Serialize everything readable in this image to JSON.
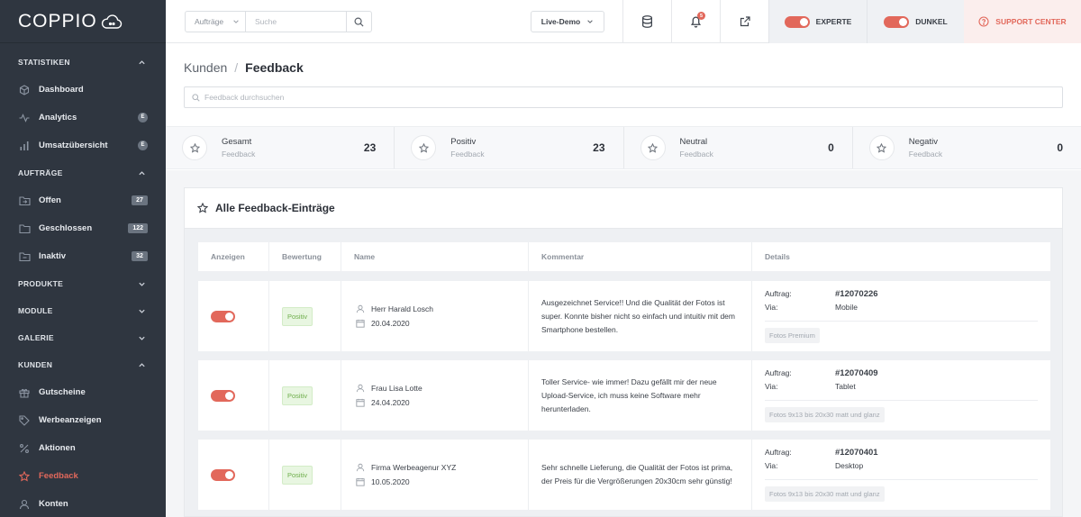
{
  "app": {
    "logo": "COPPIO"
  },
  "sidebar": {
    "sections": [
      {
        "label": "STATISTIKEN"
      },
      {
        "label": "AUFTRÄGE"
      },
      {
        "label": "PRODUKTE"
      },
      {
        "label": "MODULE"
      },
      {
        "label": "GALERIE"
      },
      {
        "label": "KUNDEN"
      }
    ],
    "items": [
      {
        "label": "Dashboard",
        "icon": "cube-icon"
      },
      {
        "label": "Analytics",
        "icon": "activity-icon",
        "badge": "E"
      },
      {
        "label": "Umsatzübersicht",
        "icon": "bar-chart-icon",
        "badge": "E"
      },
      {
        "label": "Offen",
        "icon": "folder-in-icon",
        "badge": "27"
      },
      {
        "label": "Geschlossen",
        "icon": "folder-icon",
        "badge": "122"
      },
      {
        "label": "Inaktiv",
        "icon": "folder-out-icon",
        "badge": "32"
      },
      {
        "label": "Gutscheine",
        "icon": "gift-icon"
      },
      {
        "label": "Werbeanzeigen",
        "icon": "tag-icon"
      },
      {
        "label": "Aktionen",
        "icon": "percent-icon"
      },
      {
        "label": "Feedback",
        "icon": "star-icon",
        "active": true
      },
      {
        "label": "Konten",
        "icon": "user-icon"
      }
    ]
  },
  "topbar": {
    "search_select": "Aufträge",
    "search_placeholder": "Suche",
    "live_demo": "Live-Demo",
    "notification_count": "5",
    "toggle_expert": "EXPERTE",
    "toggle_dark": "DUNKEL",
    "support": "SUPPORT CENTER"
  },
  "page": {
    "breadcrumb_parent": "Kunden",
    "breadcrumb_sep": "/",
    "breadcrumb_current": "Feedback",
    "search_placeholder": "Feedback durchsuchen"
  },
  "stats": [
    {
      "title": "Gesamt",
      "sub": "Feedback",
      "value": "23"
    },
    {
      "title": "Positiv",
      "sub": "Feedback",
      "value": "23"
    },
    {
      "title": "Neutral",
      "sub": "Feedback",
      "value": "0"
    },
    {
      "title": "Negativ",
      "sub": "Feedback",
      "value": "0"
    }
  ],
  "table": {
    "title": "Alle Feedback-Einträge",
    "headers": [
      "Anzeigen",
      "Bewertung",
      "Name",
      "Kommentar",
      "Details"
    ],
    "detail_labels": {
      "order": "Auftrag:",
      "via": "Via:"
    },
    "rows": [
      {
        "rating": "Positiv",
        "name": "Herr Harald Losch",
        "date": "20.04.2020",
        "comment": "Ausgezeichnet Service!! Und die Qualität der Fotos ist super. Konnte bisher nicht so einfach und intuitiv mit dem Smartphone bestellen.",
        "order": "#12070226",
        "via": "Mobile",
        "tag": "Fotos Premium"
      },
      {
        "rating": "Positiv",
        "name": "Frau Lisa Lotte",
        "date": "24.04.2020",
        "comment": "Toller Service- wie immer! Dazu gefällt mir der neue Upload-Service, ich muss keine Software mehr herunterladen.",
        "order": "#12070409",
        "via": "Tablet",
        "tag": "Fotos 9x13 bis 20x30 matt und glanz"
      },
      {
        "rating": "Positiv",
        "name": "Firma Werbeagenur XYZ",
        "date": "10.05.2020",
        "comment": "Sehr schnelle Lieferung, die Qualität der Fotos ist prima, der Preis für die Vergrößerungen 20x30cm sehr günstig!",
        "order": "#12070401",
        "via": "Desktop",
        "tag": "Fotos 9x13 bis 20x30 matt und glanz"
      }
    ]
  },
  "colors": {
    "accent": "#e2685b",
    "sidebar_bg": "#2f3640",
    "positive": "#6fae4c"
  }
}
